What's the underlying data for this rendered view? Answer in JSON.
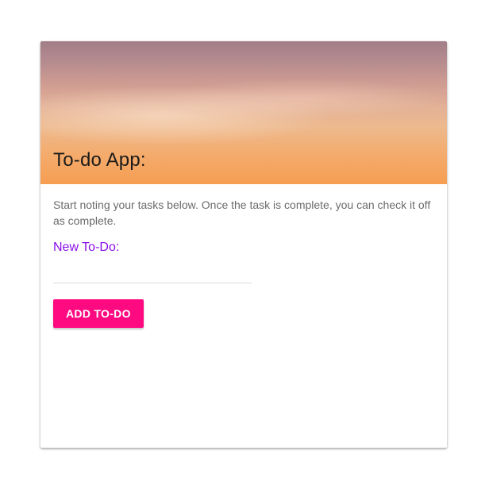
{
  "card": {
    "title": "To-do App:",
    "description": "Start noting your tasks below. Once the task is complete, you can check it off as complete.",
    "new_todo_label": "New To-Do:",
    "new_todo_value": "",
    "new_todo_placeholder": "",
    "add_button_label": "ADD TO-DO"
  },
  "colors": {
    "accent_label": "#8a0fe6",
    "button": "#ff0a81",
    "header_gradient_top": "#a27d87",
    "header_gradient_bottom": "#f69e52"
  }
}
